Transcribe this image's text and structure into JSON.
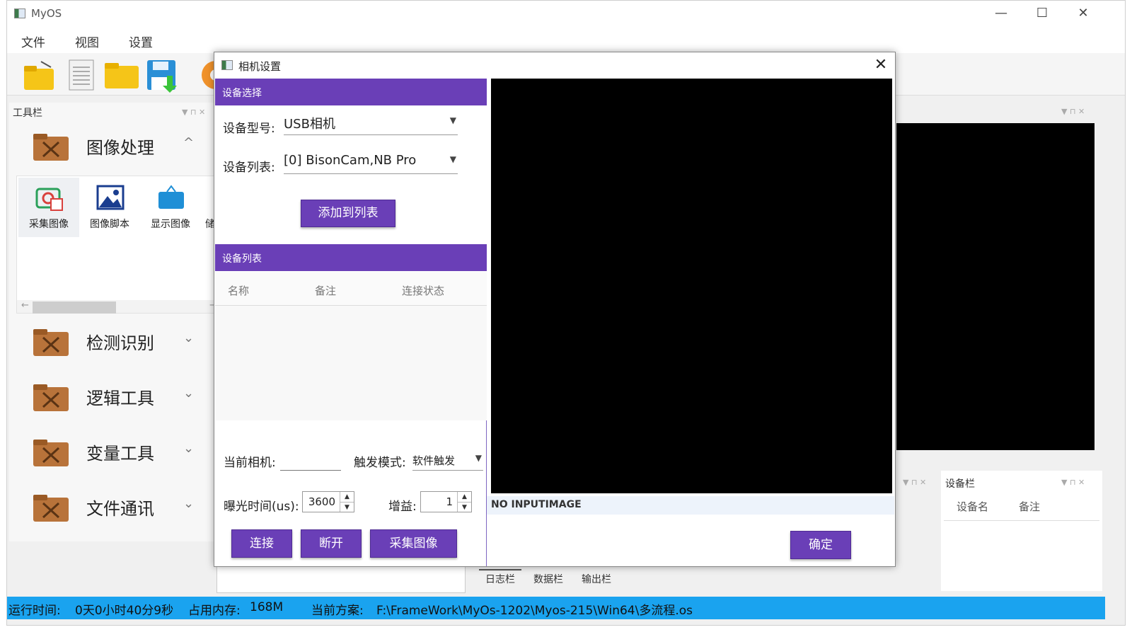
{
  "app": {
    "title": "MyOS",
    "window_controls": {
      "minimize": "—",
      "maximize": "☐",
      "close": "✕"
    }
  },
  "menu": [
    "文件",
    "视图",
    "设置"
  ],
  "toolbar_icons": [
    "open-folder-icon",
    "document-icon",
    "folder-icon",
    "save-icon",
    "camera-icon"
  ],
  "tool_dock": {
    "title": "工具栏",
    "categories": [
      {
        "label": "图像处理",
        "expanded": true
      },
      {
        "label": "检测识别",
        "expanded": false
      },
      {
        "label": "逻辑工具",
        "expanded": false
      },
      {
        "label": "变量工具",
        "expanded": false
      },
      {
        "label": "文件通讯",
        "expanded": false
      }
    ],
    "items": [
      {
        "label": "采集图像",
        "icon": "camera-capture-icon"
      },
      {
        "label": "图像脚本",
        "icon": "image-icon"
      },
      {
        "label": "显示图像",
        "icon": "show-sign-icon"
      },
      {
        "label": "储",
        "icon": "storage-icon"
      }
    ],
    "expand_icon": "^",
    "collapse_icon": "⌄"
  },
  "device_dock": {
    "title": "设备栏",
    "columns": [
      "设备名",
      "备注"
    ]
  },
  "log_tabs": [
    "日志栏",
    "数据栏",
    "输出栏"
  ],
  "status_bar": {
    "runtime_label": "运行时间:",
    "runtime_value": "0天0小时40分9秒",
    "memory_label": "占用内存:",
    "memory_value": "168M",
    "solution_label": "当前方案:",
    "solution_value": "F:\\FrameWork\\MyOs-1202\\Myos-215\\Win64\\多流程.os"
  },
  "dialog": {
    "title": "相机设置",
    "close": "✕",
    "device_select_header": "设备选择",
    "device_model_label": "设备型号:",
    "device_model_value": "USB相机",
    "device_list_label": "设备列表:",
    "device_list_value": "[0] BisonCam,NB Pro",
    "add_button": "添加到列表",
    "device_list_header": "设备列表",
    "table_columns": [
      "名称",
      "备注",
      "连接状态"
    ],
    "current_camera_label": "当前相机:",
    "current_camera_value": "",
    "trigger_mode_label": "触发模式:",
    "trigger_mode_value": "软件触发",
    "exposure_label": "曝光时间(us):",
    "exposure_value": "3600",
    "gain_label": "增益:",
    "gain_value": "1",
    "connect_button": "连接",
    "disconnect_button": "断开",
    "capture_button": "采集图像",
    "preview_status": "NO INPUTIMAGE",
    "ok_button": "确定"
  },
  "colors": {
    "accent_purple": "#6a3fb7",
    "status_bar_blue": "#1aa3ef",
    "preview_black": "#000000"
  }
}
